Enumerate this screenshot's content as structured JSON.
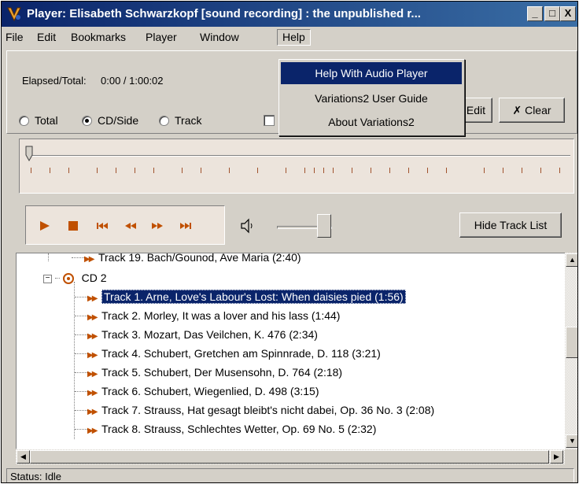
{
  "window": {
    "title": "Player: Elisabeth Schwarzkopf [sound recording] : the unpublished r..."
  },
  "titlebar_buttons": {
    "minimize": "_",
    "maximize": "□",
    "close": "X"
  },
  "menubar": {
    "items": [
      "File",
      "Edit",
      "Bookmarks",
      "Player",
      "Window",
      "Help"
    ]
  },
  "help_menu": {
    "items": [
      "Help With Audio Player",
      "Variations2 User Guide",
      "About Variations2"
    ]
  },
  "elapsed": {
    "label": "Elapsed/Total:",
    "value": "0:00 / 1:00:02"
  },
  "mode_radios": [
    {
      "label": "Total",
      "selected": false
    },
    {
      "label": "CD/Side",
      "selected": true
    },
    {
      "label": "Track",
      "selected": false
    }
  ],
  "bookmark_buttons": {
    "edit": "Edit",
    "clear": "Clear"
  },
  "transport_icons": [
    "play-icon",
    "stop-icon",
    "skip-back-icon",
    "rewind-icon",
    "fast-forward-icon",
    "skip-forward-icon"
  ],
  "volume": {
    "level": 0.85
  },
  "track_list_button": "Hide Track List",
  "tree": {
    "partial_top": "Track 19. Bach/Gounod, Ave Maria (2:40)",
    "cd_label": "CD 2",
    "tracks": [
      "Track 1. Arne, Love's Labour's Lost: When daisies pied (1:56)",
      "Track 2. Morley, It was a lover and his lass (1:44)",
      "Track 3. Mozart, Das Veilchen, K. 476 (2:34)",
      "Track 4. Schubert, Gretchen am Spinnrade, D. 118 (3:21)",
      "Track 5. Schubert, Der Musensohn, D. 764 (2:18)",
      "Track 6. Schubert, Wiegenlied, D. 498 (3:15)",
      "Track 7. Strauss, Hat gesagt bleibt's nicht dabei, Op. 36 No. 3 (2:08)",
      "Track 8. Strauss, Schlechtes Wetter, Op. 69 No. 5 (2:32)"
    ],
    "selected_index": 0
  },
  "status": {
    "text": "Status: Idle"
  },
  "colors": {
    "title_bar": "#0a246a",
    "selection": "#0a246a",
    "accent_orange": "#c05000",
    "window_bg": "#d4d0c8"
  }
}
